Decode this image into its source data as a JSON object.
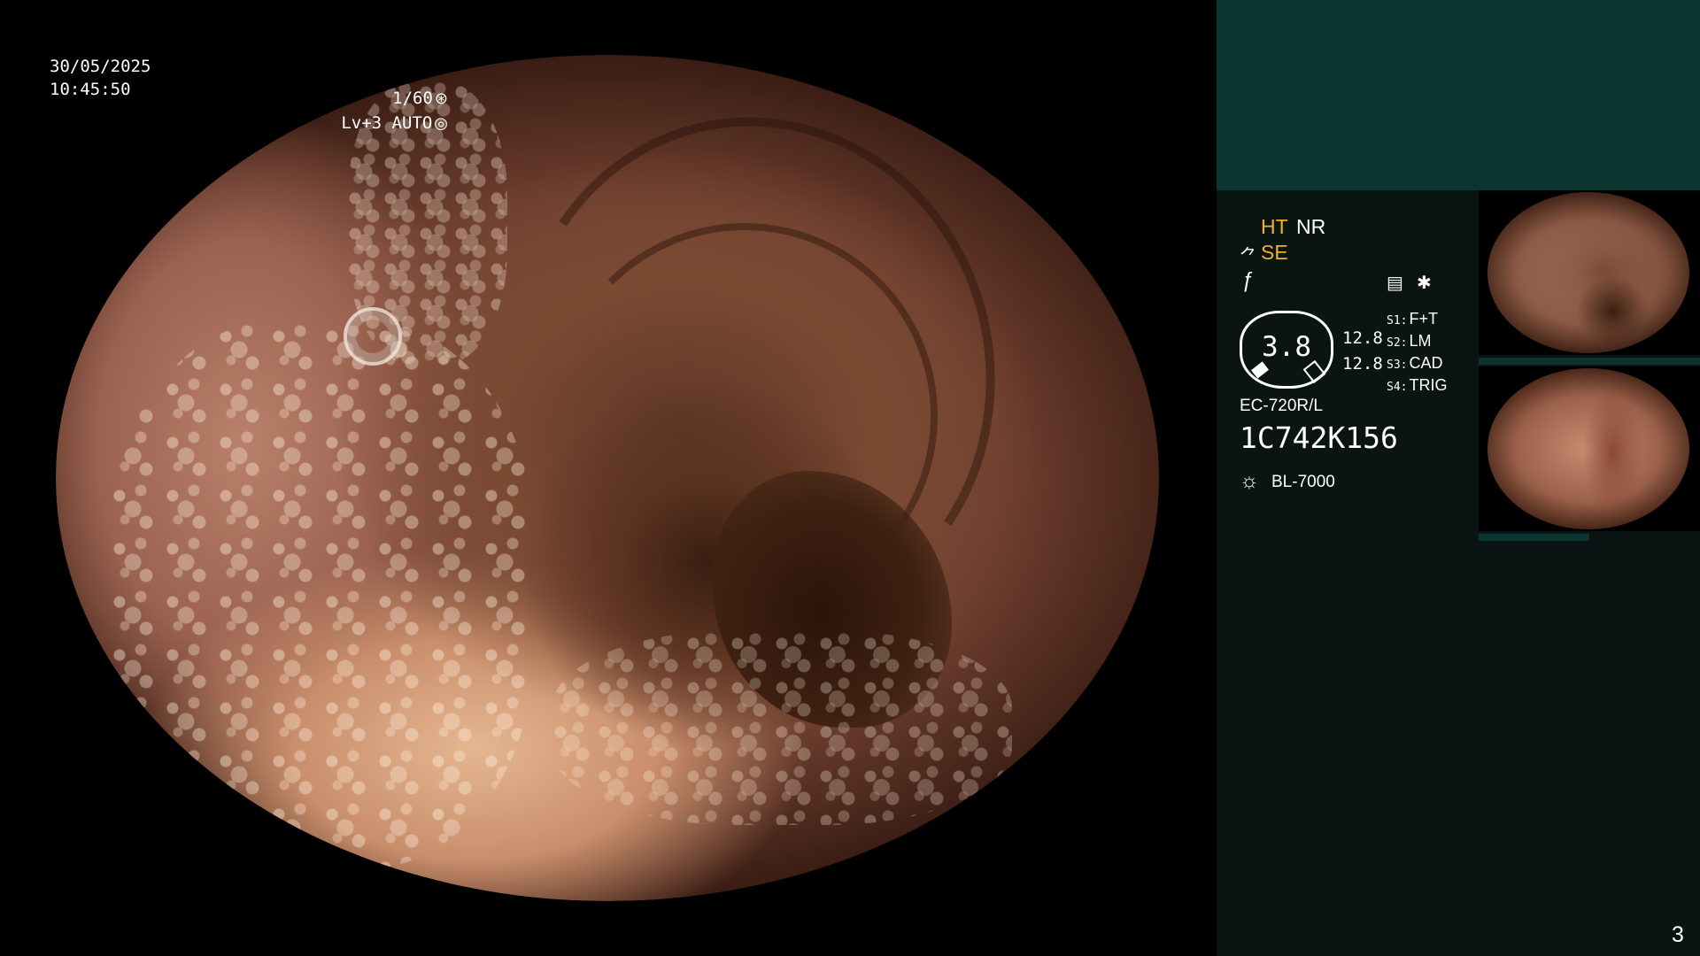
{
  "osd": {
    "date": "30/05/2025",
    "time": "10:45:50",
    "shutter": "1/60",
    "level": "Lv+3 AUTO"
  },
  "panel": {
    "ht": "HT",
    "nr": "NR",
    "se": "SE",
    "gauge_value": "3.8",
    "gauge_right_top": "12.8",
    "gauge_right_bottom": "12.8",
    "switches": [
      {
        "key": "S1",
        "value": "F+T"
      },
      {
        "key": "S2",
        "value": "LM"
      },
      {
        "key": "S3",
        "value": "CAD"
      },
      {
        "key": "S4",
        "value": "TRIG"
      }
    ],
    "scope_model": "EC-720R/L",
    "scope_serial": "1C742K156",
    "light_source": "BL-7000",
    "page_number": "3"
  },
  "icons": {
    "shutter": "aperture-icon",
    "level": "iris-icon",
    "se": "structure-enhance-icon",
    "f": "freeze-icon",
    "doc": "record-icon",
    "star": "asterisk-icon",
    "light": "light-source-icon"
  },
  "colors": {
    "panel_background": "#0a1412",
    "panel_header": "#0c3530",
    "accent_orange": "#f0b030"
  }
}
